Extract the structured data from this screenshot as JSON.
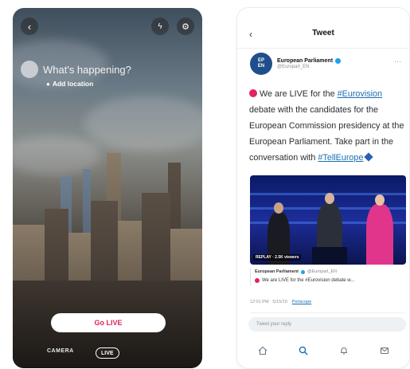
{
  "live_screen": {
    "prompt": "What's happening?",
    "add_location": "Add location",
    "go_live_button": "Go LIVE",
    "modes": {
      "camera": "CAMERA",
      "live": "LIVE"
    }
  },
  "tweet_screen": {
    "header_title": "Tweet",
    "author": {
      "name": "European Parliament",
      "handle": "@Europarl_EN",
      "avatar_text_top": "EP",
      "avatar_text_bottom": "EN"
    },
    "body": {
      "part1": "We are LIVE for the ",
      "hashtag1": "#Eurovision",
      "part2": " debate with the candidates for the European Commission presidency at the European Parliament. Take part in the conversation with ",
      "hashtag2": "#TellEurope"
    },
    "video": {
      "replay_badge": "REPLAY · 2.5K viewers"
    },
    "quoted": {
      "name": "European Parliament",
      "handle": "@Europarl_EN",
      "text": "We are LIVE for the #Eurovision debate w..."
    },
    "timestamp": "12:01 PM · 5/15/19",
    "source": "Periscope",
    "reply_placeholder": "Tweet your reply",
    "tabs": [
      "home-icon",
      "search-icon",
      "notifications-icon",
      "messages-icon"
    ]
  },
  "colors": {
    "live_red": "#e0245e",
    "link_blue": "#1b6fb5",
    "ep_blue": "#1f4e8c"
  }
}
